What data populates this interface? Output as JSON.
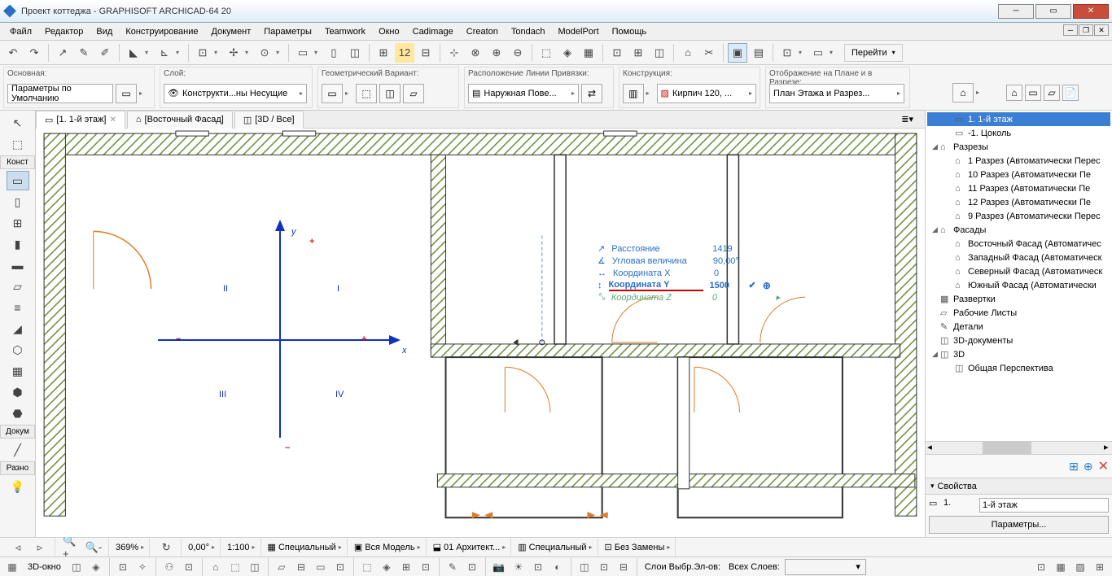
{
  "title": "Проект коттеджа - GRAPHISOFT ARCHICAD-64 20",
  "menus": [
    "Файл",
    "Редактор",
    "Вид",
    "Конструирование",
    "Документ",
    "Параметры",
    "Teamwork",
    "Окно",
    "Cadimage",
    "Creaton",
    "Tondach",
    "ModelPort",
    "Помощь"
  ],
  "goto": "Перейти",
  "groups": {
    "osnovnaya": {
      "label": "Основная:",
      "value": "Параметры по Умолчанию"
    },
    "sloy": {
      "label": "Слой:",
      "value": "Конструкти...ны Несущие"
    },
    "geom": {
      "label": "Геометрический Вариант:"
    },
    "privyazka": {
      "label": "Расположение Линии Привязки:",
      "value": "Наружная Пове..."
    },
    "konstr": {
      "label": "Конструкция:",
      "value": "Кирпич 120, ..."
    },
    "otobr": {
      "label": "Отображение на Плане и в Разрезе:",
      "value": "План Этажа и Разрез..."
    }
  },
  "tabs": [
    {
      "label": "[1. 1-й этаж]",
      "active": true,
      "icon": "▭"
    },
    {
      "label": "[Восточный Фасад]",
      "icon": "⌂"
    },
    {
      "label": "[3D / Все]",
      "icon": "◫"
    }
  ],
  "toolbox_labels": {
    "konst": "Конст",
    "dokum": "Докум",
    "razno": "Разно"
  },
  "tracker": {
    "distance_label": "Расстояние",
    "distance": "1419",
    "angle_label": "Угловая величина",
    "angle": "90,00°",
    "x_label": "Координата X",
    "x": "0",
    "y_label": "Координата Y",
    "y": "1500",
    "z_label": "Координата Z",
    "z": "0"
  },
  "axes": {
    "x": "x",
    "y": "y",
    "q1": "I",
    "q2": "II",
    "q3": "III",
    "q4": "IV"
  },
  "nav": {
    "items": [
      {
        "lvl": 1,
        "ic": "▭",
        "text": "1. 1-й этаж",
        "sel": true
      },
      {
        "lvl": 1,
        "ic": "▭",
        "text": "-1. Цоколь"
      },
      {
        "lvl": 0,
        "ex": "◢",
        "ic": "⌂",
        "text": "Разрезы"
      },
      {
        "lvl": 1,
        "ic": "⌂",
        "text": "1 Разрез (Автоматически Перес"
      },
      {
        "lvl": 1,
        "ic": "⌂",
        "text": "10 Разрез (Автоматически Пе"
      },
      {
        "lvl": 1,
        "ic": "⌂",
        "text": "11 Разрез (Автоматически Пе"
      },
      {
        "lvl": 1,
        "ic": "⌂",
        "text": "12 Разрез (Автоматически Пе"
      },
      {
        "lvl": 1,
        "ic": "⌂",
        "text": "9 Разрез (Автоматически Перес"
      },
      {
        "lvl": 0,
        "ex": "◢",
        "ic": "⌂",
        "text": "Фасады"
      },
      {
        "lvl": 1,
        "ic": "⌂",
        "text": "Восточный Фасад (Автоматичес"
      },
      {
        "lvl": 1,
        "ic": "⌂",
        "text": "Западный Фасад (Автоматическ"
      },
      {
        "lvl": 1,
        "ic": "⌂",
        "text": "Северный Фасад (Автоматическ"
      },
      {
        "lvl": 1,
        "ic": "⌂",
        "text": "Южный Фасад (Автоматически"
      },
      {
        "lvl": 0,
        "ic": "▦",
        "text": "Развертки"
      },
      {
        "lvl": 0,
        "ic": "▱",
        "text": "Рабочие Листы"
      },
      {
        "lvl": 0,
        "ic": "✎",
        "text": "Детали"
      },
      {
        "lvl": 0,
        "ic": "◫",
        "text": "3D-документы"
      },
      {
        "lvl": 0,
        "ex": "◢",
        "ic": "◫",
        "text": "3D"
      },
      {
        "lvl": 1,
        "ic": "◫",
        "text": "Общая Перспектива"
      }
    ]
  },
  "props": {
    "header": "Свойства",
    "id": "1.",
    "name": "1-й этаж",
    "params": "Параметры..."
  },
  "status": {
    "zoom": "369%",
    "angle": "0,00°",
    "scale": "1:100",
    "special": "Специальный",
    "model": "Вся Модель",
    "arch": "01 Архитект...",
    "special2": "Специальный",
    "zamena": "Без Замены"
  },
  "bottom": {
    "okno3d": "3D-окно",
    "layers": "Слои Выбр.Эл-ов:",
    "alllayers": "Всех Слоев:"
  }
}
